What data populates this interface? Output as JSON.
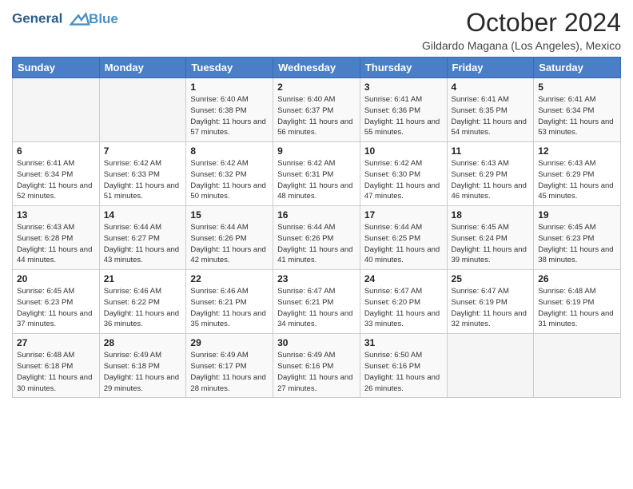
{
  "logo": {
    "line1": "General",
    "line2": "Blue"
  },
  "title": "October 2024",
  "subtitle": "Gildardo Magana (Los Angeles), Mexico",
  "days_of_week": [
    "Sunday",
    "Monday",
    "Tuesday",
    "Wednesday",
    "Thursday",
    "Friday",
    "Saturday"
  ],
  "weeks": [
    [
      {
        "day": "",
        "info": ""
      },
      {
        "day": "",
        "info": ""
      },
      {
        "day": "1",
        "info": "Sunrise: 6:40 AM\nSunset: 6:38 PM\nDaylight: 11 hours and 57 minutes."
      },
      {
        "day": "2",
        "info": "Sunrise: 6:40 AM\nSunset: 6:37 PM\nDaylight: 11 hours and 56 minutes."
      },
      {
        "day": "3",
        "info": "Sunrise: 6:41 AM\nSunset: 6:36 PM\nDaylight: 11 hours and 55 minutes."
      },
      {
        "day": "4",
        "info": "Sunrise: 6:41 AM\nSunset: 6:35 PM\nDaylight: 11 hours and 54 minutes."
      },
      {
        "day": "5",
        "info": "Sunrise: 6:41 AM\nSunset: 6:34 PM\nDaylight: 11 hours and 53 minutes."
      }
    ],
    [
      {
        "day": "6",
        "info": "Sunrise: 6:41 AM\nSunset: 6:34 PM\nDaylight: 11 hours and 52 minutes."
      },
      {
        "day": "7",
        "info": "Sunrise: 6:42 AM\nSunset: 6:33 PM\nDaylight: 11 hours and 51 minutes."
      },
      {
        "day": "8",
        "info": "Sunrise: 6:42 AM\nSunset: 6:32 PM\nDaylight: 11 hours and 50 minutes."
      },
      {
        "day": "9",
        "info": "Sunrise: 6:42 AM\nSunset: 6:31 PM\nDaylight: 11 hours and 48 minutes."
      },
      {
        "day": "10",
        "info": "Sunrise: 6:42 AM\nSunset: 6:30 PM\nDaylight: 11 hours and 47 minutes."
      },
      {
        "day": "11",
        "info": "Sunrise: 6:43 AM\nSunset: 6:29 PM\nDaylight: 11 hours and 46 minutes."
      },
      {
        "day": "12",
        "info": "Sunrise: 6:43 AM\nSunset: 6:29 PM\nDaylight: 11 hours and 45 minutes."
      }
    ],
    [
      {
        "day": "13",
        "info": "Sunrise: 6:43 AM\nSunset: 6:28 PM\nDaylight: 11 hours and 44 minutes."
      },
      {
        "day": "14",
        "info": "Sunrise: 6:44 AM\nSunset: 6:27 PM\nDaylight: 11 hours and 43 minutes."
      },
      {
        "day": "15",
        "info": "Sunrise: 6:44 AM\nSunset: 6:26 PM\nDaylight: 11 hours and 42 minutes."
      },
      {
        "day": "16",
        "info": "Sunrise: 6:44 AM\nSunset: 6:26 PM\nDaylight: 11 hours and 41 minutes."
      },
      {
        "day": "17",
        "info": "Sunrise: 6:44 AM\nSunset: 6:25 PM\nDaylight: 11 hours and 40 minutes."
      },
      {
        "day": "18",
        "info": "Sunrise: 6:45 AM\nSunset: 6:24 PM\nDaylight: 11 hours and 39 minutes."
      },
      {
        "day": "19",
        "info": "Sunrise: 6:45 AM\nSunset: 6:23 PM\nDaylight: 11 hours and 38 minutes."
      }
    ],
    [
      {
        "day": "20",
        "info": "Sunrise: 6:45 AM\nSunset: 6:23 PM\nDaylight: 11 hours and 37 minutes."
      },
      {
        "day": "21",
        "info": "Sunrise: 6:46 AM\nSunset: 6:22 PM\nDaylight: 11 hours and 36 minutes."
      },
      {
        "day": "22",
        "info": "Sunrise: 6:46 AM\nSunset: 6:21 PM\nDaylight: 11 hours and 35 minutes."
      },
      {
        "day": "23",
        "info": "Sunrise: 6:47 AM\nSunset: 6:21 PM\nDaylight: 11 hours and 34 minutes."
      },
      {
        "day": "24",
        "info": "Sunrise: 6:47 AM\nSunset: 6:20 PM\nDaylight: 11 hours and 33 minutes."
      },
      {
        "day": "25",
        "info": "Sunrise: 6:47 AM\nSunset: 6:19 PM\nDaylight: 11 hours and 32 minutes."
      },
      {
        "day": "26",
        "info": "Sunrise: 6:48 AM\nSunset: 6:19 PM\nDaylight: 11 hours and 31 minutes."
      }
    ],
    [
      {
        "day": "27",
        "info": "Sunrise: 6:48 AM\nSunset: 6:18 PM\nDaylight: 11 hours and 30 minutes."
      },
      {
        "day": "28",
        "info": "Sunrise: 6:49 AM\nSunset: 6:18 PM\nDaylight: 11 hours and 29 minutes."
      },
      {
        "day": "29",
        "info": "Sunrise: 6:49 AM\nSunset: 6:17 PM\nDaylight: 11 hours and 28 minutes."
      },
      {
        "day": "30",
        "info": "Sunrise: 6:49 AM\nSunset: 6:16 PM\nDaylight: 11 hours and 27 minutes."
      },
      {
        "day": "31",
        "info": "Sunrise: 6:50 AM\nSunset: 6:16 PM\nDaylight: 11 hours and 26 minutes."
      },
      {
        "day": "",
        "info": ""
      },
      {
        "day": "",
        "info": ""
      }
    ]
  ]
}
